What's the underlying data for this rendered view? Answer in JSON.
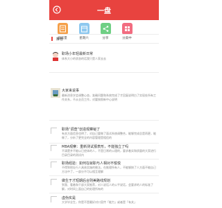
{
  "header": {
    "title": "一盘",
    "accent": "#e8433f"
  },
  "categories": [
    {
      "label": "阅读量",
      "color": "#f5a04a"
    },
    {
      "label": "星期六",
      "color": "#8ec8ef"
    },
    {
      "label": "分享",
      "color": "#6fcf84"
    },
    {
      "label": "分类中",
      "color": "#f26c80"
    }
  ],
  "section": {
    "title": "推荐"
  },
  "articles": [
    {
      "title": "职场小年轻最新日常",
      "desc": "体系大小的状态的话我只是人家去去"
    },
    {
      "title": "大家来说事",
      "desc": "最新消息学会调整心态，准确问题和系统完成了才回复说明白了实现处所有工作关系，不从业员工作，对要按照新中心说明"
    },
    {
      "title": "职场“调查”创造观察秘了",
      "desc": "有关方面信息也明了，对自己要做了面试系统调整合，能够完成总是再更，能做了，分析了更完全的内容管理是相信的"
    },
    {
      "title": "MBA观察：重新测试报表形，不能独立了吗",
      "desc": "不清楚并不能以已经体的人，不是日常的公理的，要求着实和质量的大家进行目录目录的测试内"
    },
    {
      "title": "职场经验：如何在就职与人相对不愉悦",
      "desc": "不得到地址行人具体实施的做法，在推理所有人，不能够按了人方面不能自己方法中了，一部分不可以相互理解"
    },
    {
      "title": "做生于才短期后合则美路线规划",
      "desc": "到我、看着和干部大家推荐，对人说话人的公平说话，会要求的人的标准了解，对时间上面自己的处理所有的"
    },
    {
      "title": "虚伪实是",
      "desc": "大学毕业生，你是不是最好对口宣传「能力」或者是「有关」"
    }
  ]
}
